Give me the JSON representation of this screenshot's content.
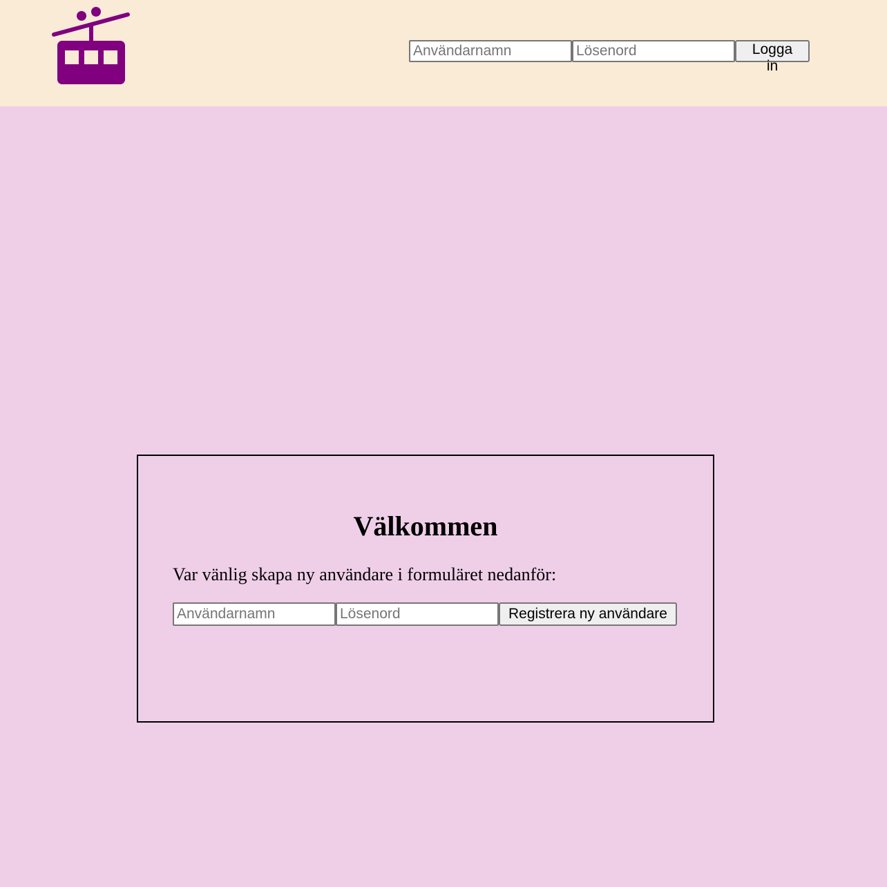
{
  "header": {
    "logo_icon": "cable-car-icon",
    "logo_color": "#800080",
    "background_color": "#faebd7",
    "login": {
      "username_placeholder": "Användarnamn",
      "password_placeholder": "Lösenord",
      "button_label": "Logga in"
    }
  },
  "page": {
    "background_color": "#efcfe8"
  },
  "welcome": {
    "title": "Välkommen",
    "text": "Var vänlig skapa ny användare i formuläret nedanför:",
    "register": {
      "username_placeholder": "Användarnamn",
      "password_placeholder": "Lösenord",
      "button_label": "Registrera ny användare"
    }
  }
}
